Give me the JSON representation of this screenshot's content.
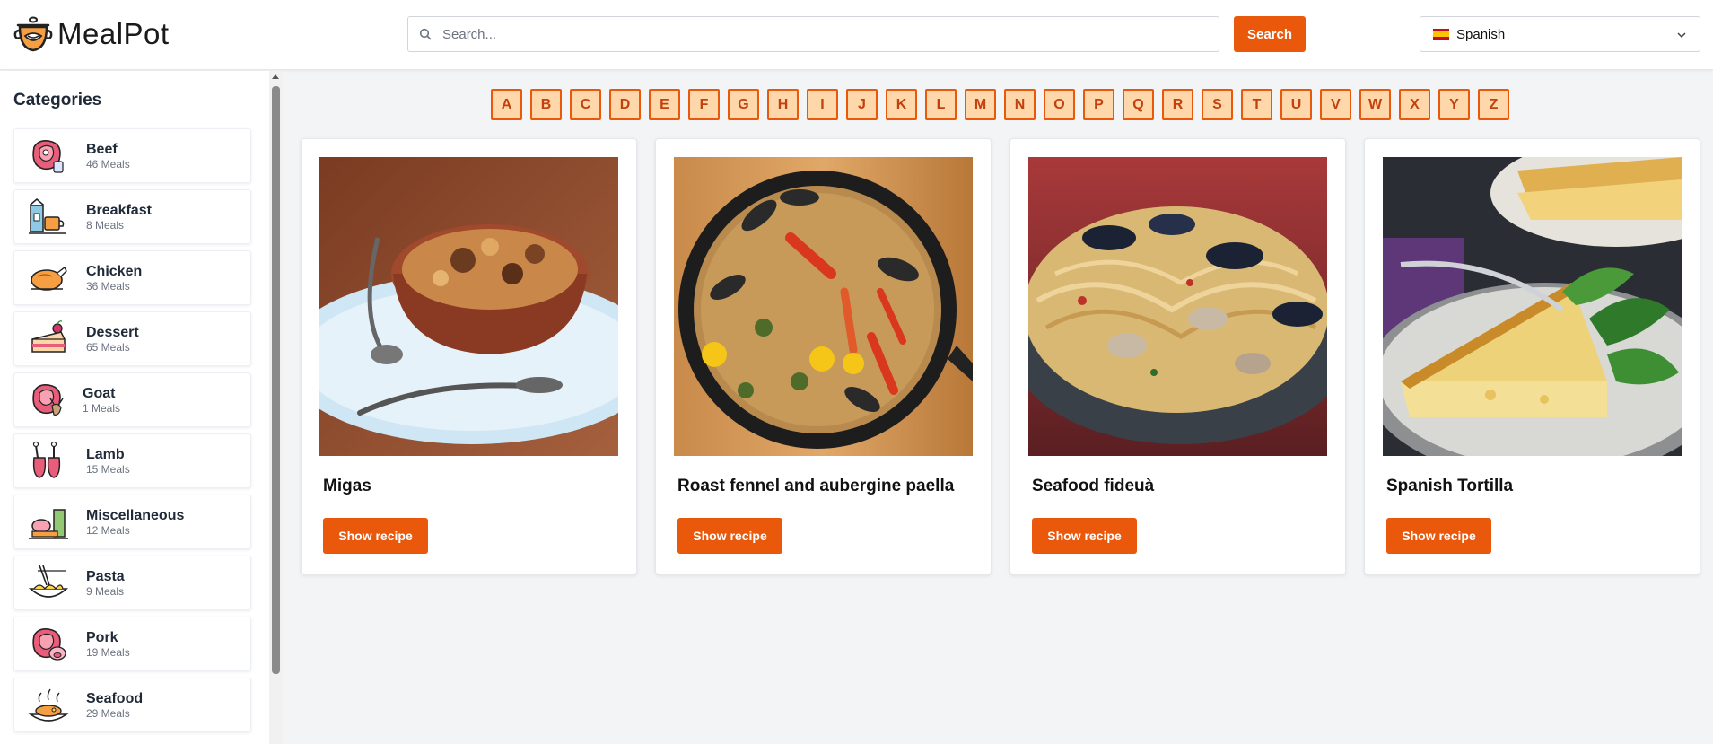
{
  "header": {
    "logo_text": "MealPot",
    "search_placeholder": "Search...",
    "search_button": "Search",
    "language": "Spanish"
  },
  "sidebar": {
    "title": "Categories",
    "items": [
      {
        "name": "Beef",
        "count": "46 Meals",
        "icon": "beef-icon"
      },
      {
        "name": "Breakfast",
        "count": "8 Meals",
        "icon": "breakfast-icon"
      },
      {
        "name": "Chicken",
        "count": "36 Meals",
        "icon": "chicken-icon"
      },
      {
        "name": "Dessert",
        "count": "65 Meals",
        "icon": "dessert-icon"
      },
      {
        "name": "Goat",
        "count": "1 Meals",
        "icon": "goat-icon"
      },
      {
        "name": "Lamb",
        "count": "15 Meals",
        "icon": "lamb-icon"
      },
      {
        "name": "Miscellaneous",
        "count": "12 Meals",
        "icon": "miscellaneous-icon"
      },
      {
        "name": "Pasta",
        "count": "9 Meals",
        "icon": "pasta-icon"
      },
      {
        "name": "Pork",
        "count": "19 Meals",
        "icon": "pork-icon"
      },
      {
        "name": "Seafood",
        "count": "29 Meals",
        "icon": "seafood-icon"
      }
    ]
  },
  "letters": [
    "A",
    "B",
    "C",
    "D",
    "E",
    "F",
    "G",
    "H",
    "I",
    "J",
    "K",
    "L",
    "M",
    "N",
    "O",
    "P",
    "Q",
    "R",
    "S",
    "T",
    "U",
    "V",
    "W",
    "X",
    "Y",
    "Z"
  ],
  "meals": [
    {
      "title": "Migas",
      "button": "Show recipe"
    },
    {
      "title": "Roast fennel and aubergine paella",
      "button": "Show recipe"
    },
    {
      "title": "Seafood fideuà",
      "button": "Show recipe"
    },
    {
      "title": "Spanish Tortilla",
      "button": "Show recipe"
    }
  ],
  "colors": {
    "accent": "#ea580c",
    "letter_bg": "#fed7aa",
    "page_bg": "#f3f4f6"
  }
}
